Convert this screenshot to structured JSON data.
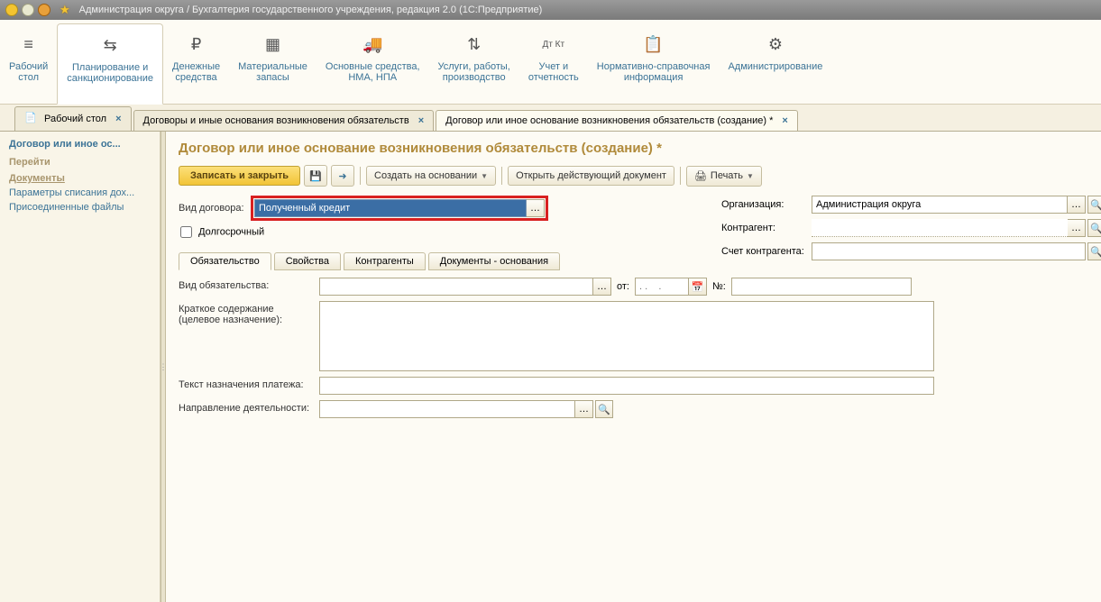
{
  "app": {
    "title": "Администрация округа / Бухгалтерия государственного учреждения, редакция 2.0  (1С:Предприятие)"
  },
  "topnav": [
    {
      "label": "Рабочий\nстол"
    },
    {
      "label": "Планирование и\nсанкционирование"
    },
    {
      "label": "Денежные\nсредства"
    },
    {
      "label": "Материальные\nзапасы"
    },
    {
      "label": "Основные средства,\nНМА, НПА"
    },
    {
      "label": "Услуги, работы,\nпроизводство"
    },
    {
      "label": "Учет и\nотчетность"
    },
    {
      "label": "Нормативно-справочная\nинформация"
    },
    {
      "label": "Администрирование"
    }
  ],
  "tabs": {
    "t0": "Рабочий стол",
    "t1": "Договоры и иные основания возникновения обязательств",
    "t2": "Договор или иное основание возникновения обязательств (создание) *"
  },
  "sidebar": {
    "title": "Договор или иное ос...",
    "sec_goto": "Перейти",
    "sec_docs": "Документы",
    "link1": "Параметры списания дох...",
    "link2": "Присоединенные файлы"
  },
  "page": {
    "heading": "Договор или иное основание возникновения обязательств (создание) *"
  },
  "toolbar": {
    "save_close": "Записать и закрыть",
    "create_based": "Создать на основании",
    "open_current": "Открыть действующий документ",
    "print": "Печать"
  },
  "form": {
    "contract_type_label": "Вид договора:",
    "contract_type_value": "Полученный кредит",
    "longterm_label": "Долгосрочный",
    "org_label": "Организация:",
    "org_value": "Администрация округа",
    "counterparty_label": "Контрагент:",
    "counterparty_account_label": "Счет контрагента:"
  },
  "subtabs": {
    "t0": "Обязательство",
    "t1": "Свойства",
    "t2": "Контрагенты",
    "t3": "Документы - основания"
  },
  "fields": {
    "obligation_type": "Вид обязательства:",
    "from": "от:",
    "date_placeholder": ". .    .",
    "num": "№:",
    "summary": "Краткое содержание\n(целевое назначение):",
    "payment_text": "Текст назначения платежа:",
    "activity": "Направление деятельности:"
  }
}
